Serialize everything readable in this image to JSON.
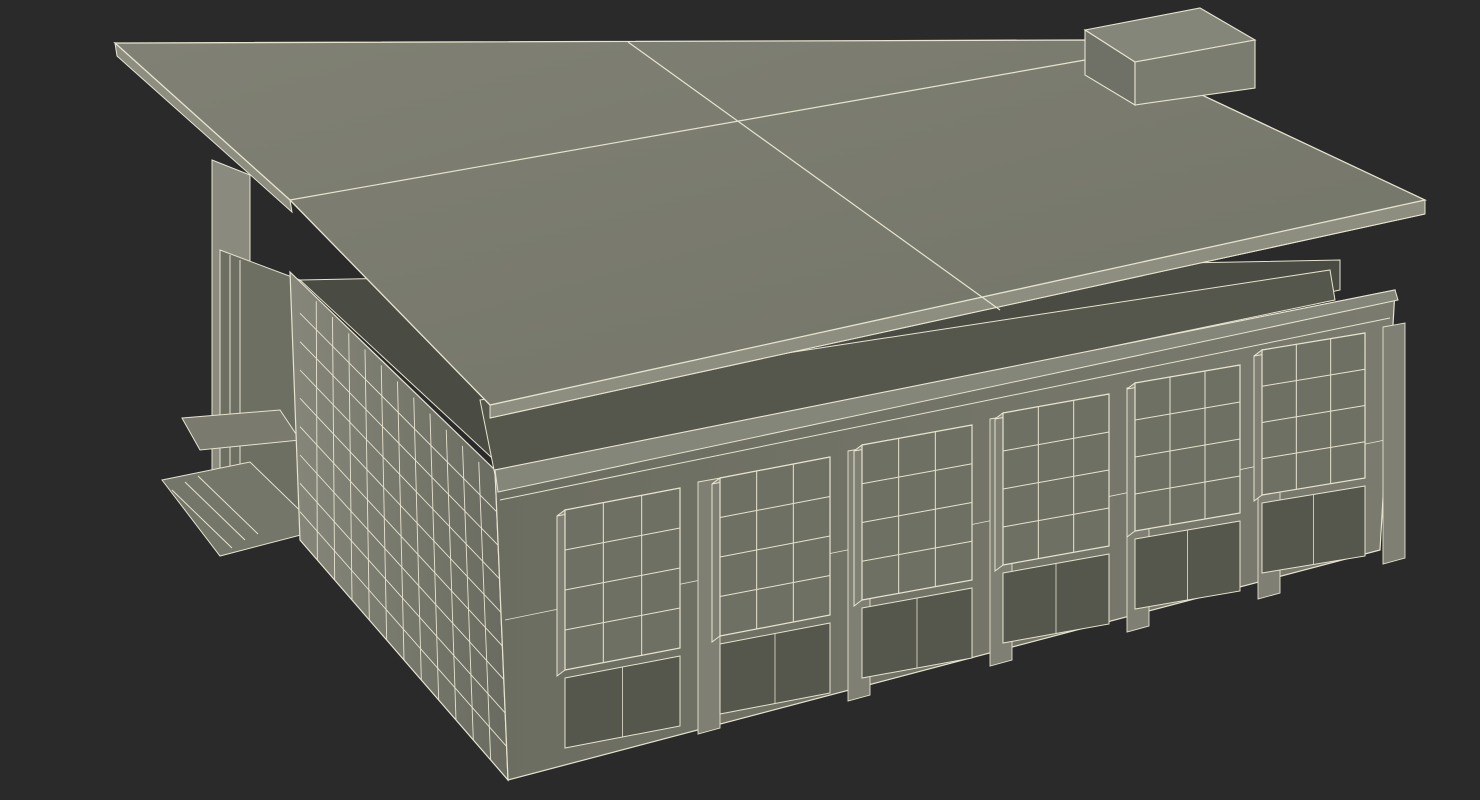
{
  "viewport": {
    "background": "#2a2a2a"
  },
  "model": {
    "subject": "building-wireframe-render",
    "colors": {
      "roof_top": "#7a7b6e",
      "roof_edge": "#8d8e80",
      "wall_light": "#7f8073",
      "wall_mid": "#6f7064",
      "wall_dark": "#55564c",
      "recess": "#3f4039",
      "wire": "#e6e3cf",
      "shadow": "#34352f"
    }
  }
}
